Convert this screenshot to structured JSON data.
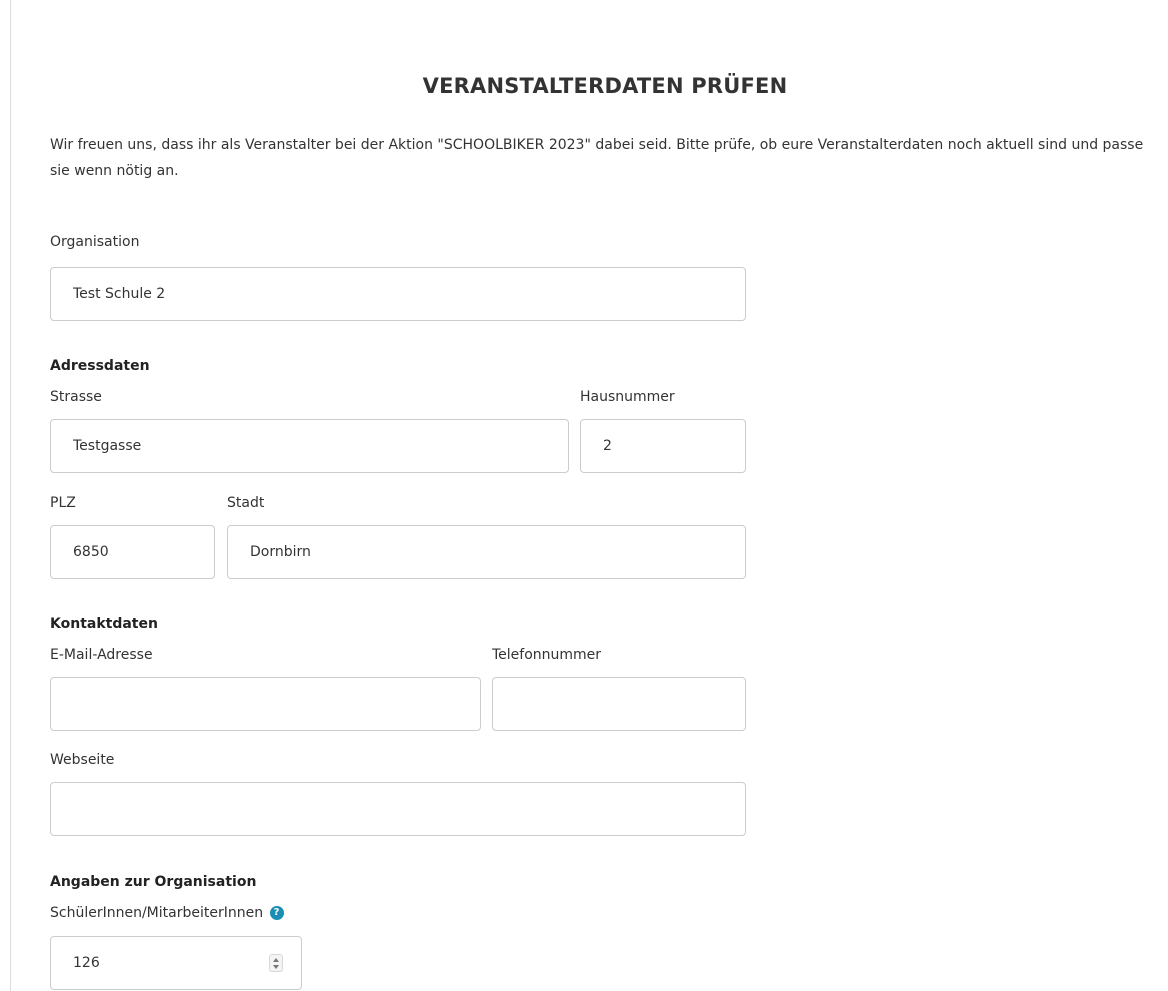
{
  "header": {
    "title": "VERANSTALTERDATEN PRÜFEN",
    "intro": "Wir freuen uns, dass ihr als Veranstalter bei der Aktion \"SCHOOLBIKER 2023\" dabei seid. Bitte prüfe, ob eure Veranstalterdaten noch aktuell sind und passe sie wenn nötig an."
  },
  "organisation": {
    "label": "Organisation",
    "value": "Test Schule 2"
  },
  "address": {
    "heading": "Adressdaten",
    "street_label": "Strasse",
    "street_value": "Testgasse",
    "house_label": "Hausnummer",
    "house_value": "2",
    "zip_label": "PLZ",
    "zip_value": "6850",
    "city_label": "Stadt",
    "city_value": "Dornbirn"
  },
  "contact": {
    "heading": "Kontaktdaten",
    "email_label": "E-Mail-Adresse",
    "email_value": "",
    "phone_label": "Telefonnummer",
    "phone_value": "",
    "website_label": "Webseite",
    "website_value": ""
  },
  "org_details": {
    "heading": "Angaben zur Organisation",
    "count_label": "SchülerInnen/MitarbeiterInnen",
    "help_icon": "question-circle-icon",
    "help_glyph": "?",
    "count_value": "126"
  },
  "colors": {
    "accent": "#1a8fb3",
    "border": "#cccccc",
    "text": "#333333"
  }
}
